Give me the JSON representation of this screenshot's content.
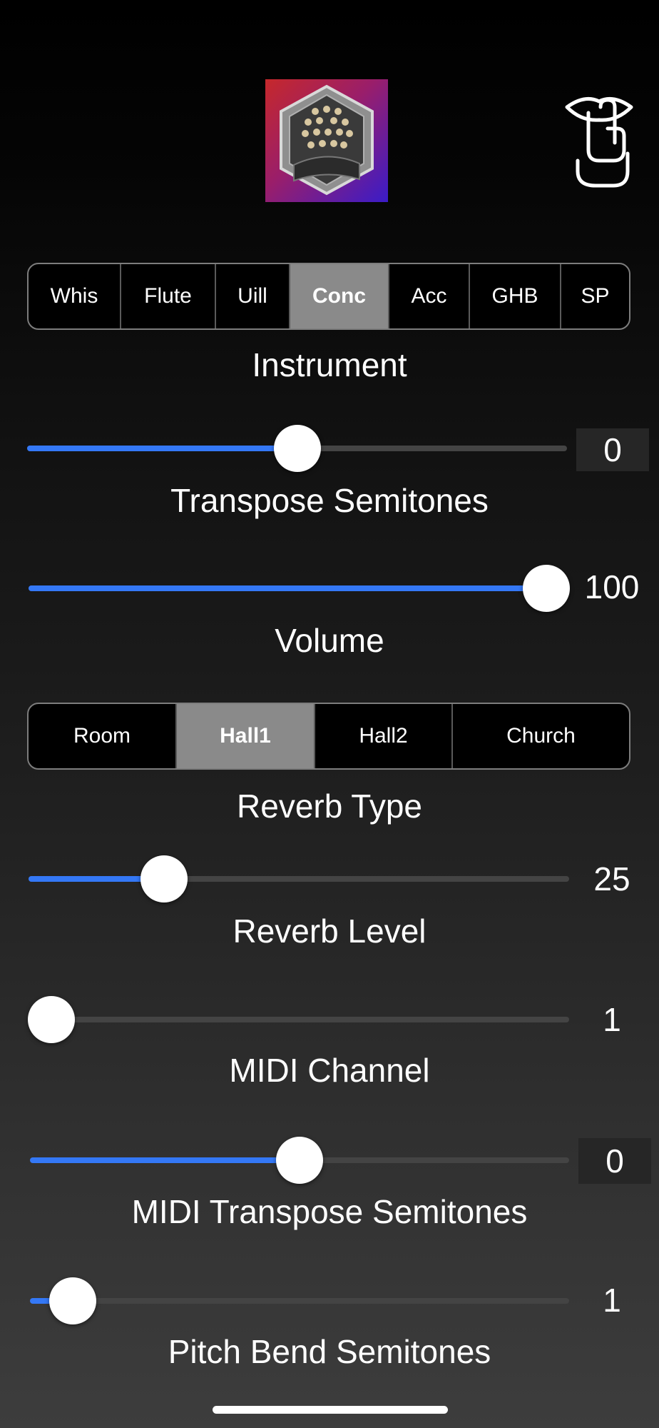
{
  "header": {
    "instrument_image_icon": "concertina-image",
    "mute_icon": "shush-icon"
  },
  "instrument": {
    "segments": [
      "Whis",
      "Flute",
      "Uill",
      "Conc",
      "Acc",
      "GHB",
      "SP"
    ],
    "selected": "Conc",
    "label": "Instrument"
  },
  "transpose": {
    "label": "Transpose Semitones",
    "value": "0",
    "level": 0.5
  },
  "volume": {
    "label": "Volume",
    "value": "100",
    "level": 1.0
  },
  "reverb_type": {
    "segments": [
      "Room",
      "Hall1",
      "Hall2",
      "Church"
    ],
    "selected": "Hall1",
    "label": "Reverb Type"
  },
  "reverb_level": {
    "label": "Reverb Level",
    "value": "25",
    "level": 0.25
  },
  "midi_channel": {
    "label": "MIDI Channel",
    "value": "1",
    "level": 0.0
  },
  "midi_transpose": {
    "label": "MIDI Transpose Semitones",
    "value": "0",
    "level": 0.5
  },
  "pitch_bend": {
    "label": "Pitch Bend Semitones",
    "value": "1",
    "level": 0.08
  },
  "colors": {
    "accent": "#3478f6",
    "selected_segment": "#8a8a8a",
    "track": "#444444"
  }
}
